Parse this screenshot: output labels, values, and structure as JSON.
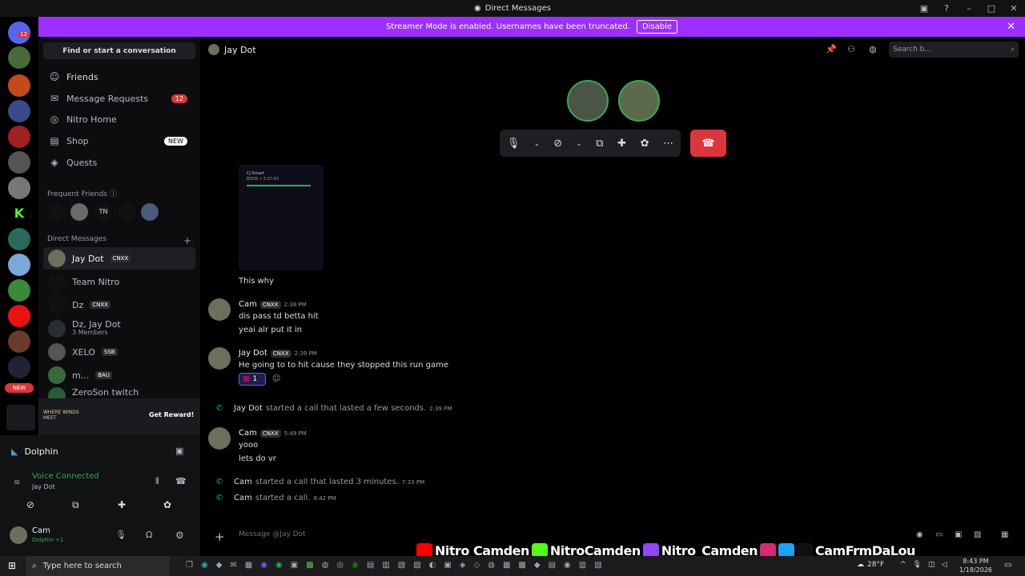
{
  "window": {
    "title": "Direct Messages"
  },
  "banner": {
    "text": "Streamer Mode is enabled. Usernames have been truncated.",
    "button": "Disable"
  },
  "guild_badge": "12",
  "guild_new": "NEW",
  "sidebar": {
    "find": "Find or start a conversation",
    "nav": [
      {
        "label": "Friends",
        "icon": "friends-icon"
      },
      {
        "label": "Message Requests",
        "icon": "envelope-icon",
        "badge": "12"
      },
      {
        "label": "Nitro Home",
        "icon": "nitro-icon"
      },
      {
        "label": "Shop",
        "icon": "shop-icon",
        "badge": "NEW"
      },
      {
        "label": "Quests",
        "icon": "quests-icon"
      }
    ],
    "frequent_friends": "Frequent Friends",
    "direct_messages": "Direct Messages",
    "dms": [
      {
        "name": "Jay Dot",
        "tag": "CNXX"
      },
      {
        "name": "Team Nitro"
      },
      {
        "name": "Dz",
        "tag": "CNXX"
      },
      {
        "name": "Dz, Jay Dot",
        "sub": "3 Members"
      },
      {
        "name": "XELO",
        "tag": "SSB"
      },
      {
        "name": "m...",
        "tag": "BAU"
      },
      {
        "name": "ZeroSon twitch"
      }
    ]
  },
  "promo": {
    "brand": "WHERE WINDS MEET",
    "button": "Get Reward!"
  },
  "panel": {
    "server": "Dolphin",
    "voice_status": "Voice Connected",
    "voice_channel": "Jay Dot",
    "user": "Cam",
    "user_status": "Dolphin +1"
  },
  "chat": {
    "recipient": "Jay Dot",
    "search_placeholder": "Search b...",
    "input_placeholder": "Message @Jay Dot",
    "image_preview": {
      "line1": "CJ Smart",
      "line2": "BOOK • 3:27:43"
    },
    "messages": [
      {
        "text": "This why"
      },
      {
        "author": "Cam",
        "tag": "CNXX",
        "time": "2:38 PM",
        "lines": [
          "dis pass td betta hit",
          "yeai alr put it in"
        ]
      },
      {
        "author": "Jay Dot",
        "tag": "CNXX",
        "time": "2:39 PM",
        "lines": [
          "He going to to hit cause they stopped this run game"
        ],
        "reaction_count": "1"
      },
      {
        "author": "Jay Dot",
        "text": "started a call that lasted a few seconds.",
        "time": "2:39 PM"
      },
      {
        "author": "Cam",
        "tag": "CNXX",
        "time": "5:49 PM",
        "lines": [
          "yooo",
          "lets do vr"
        ]
      },
      {
        "author": "Cam",
        "text": "started a call that lasted 3 minutes.",
        "time": "7:33 PM"
      },
      {
        "author": "Cam",
        "text": "started a call.",
        "time": "8:42 PM"
      }
    ]
  },
  "overlay": {
    "youtube": "Nitro Camden",
    "kick": "NitroCamden",
    "twitch": "Nitro_Camden",
    "socials": "CamFrmDaLou"
  },
  "taskbar": {
    "search": "Type here to search",
    "temp": "28°F",
    "time": "8:43 PM",
    "date": "1/18/2026"
  },
  "colors": {
    "banner": "#9b30ff",
    "hangup": "#da373c",
    "online": "#3ba55c",
    "accent": "#5865f2"
  }
}
